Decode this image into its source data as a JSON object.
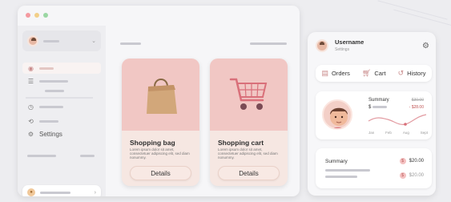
{
  "sidebar": {
    "settings_label": "Settings"
  },
  "cards": [
    {
      "title": "Shopping bag",
      "description": "Lorem ipsum dolor sit amet, consectetuer adipiscing elit, sed diam nonummy.",
      "button": "Details",
      "icon": "shopping-bag-icon"
    },
    {
      "title": "Shopping cart",
      "description": "Lorem ipsum dolor sit amet, consectetuer adipiscing elit, sed diam nonummy.",
      "button": "Details",
      "icon": "shopping-cart-icon"
    }
  ],
  "panel": {
    "username": "Username",
    "subtitle": "Settings",
    "tabs": [
      {
        "label": "Orders",
        "icon": "clipboard-icon"
      },
      {
        "label": "Cart",
        "icon": "cart-icon"
      },
      {
        "label": "History",
        "icon": "history-icon"
      }
    ],
    "summary_card": {
      "title": "Summary",
      "currency": "$",
      "old_value": "$30.00",
      "new_value": "- $28.00",
      "months": [
        "Jan",
        "Feb",
        "Aug",
        "Sept"
      ]
    },
    "bottom_card": {
      "title": "Summary",
      "amounts": [
        "$20.00",
        "$20.00"
      ]
    }
  },
  "colors": {
    "card_pink": "#f1c7c4",
    "accent": "#c98a8a",
    "window": "#f6f6f8"
  }
}
